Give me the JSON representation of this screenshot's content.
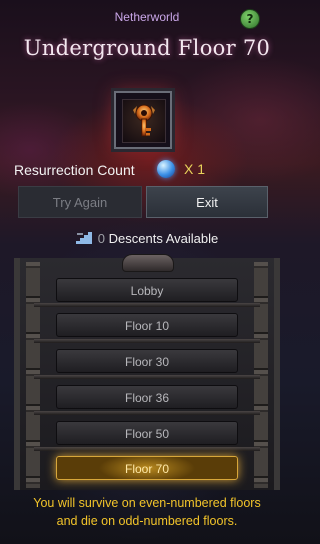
{
  "header": {
    "subtitle": "Netherworld",
    "title": "Underground Floor 70",
    "help_label": "?"
  },
  "reward": {
    "icon": "key-icon"
  },
  "resurrection": {
    "label": "Resurrection Count",
    "orb_icon": "blue-orb-icon",
    "count_text": "X 1"
  },
  "buttons": {
    "try_again": "Try Again",
    "exit": "Exit"
  },
  "descents": {
    "icon": "stairs-icon",
    "count": "0",
    "label": "Descents Available"
  },
  "floors": [
    {
      "label": "Lobby",
      "active": false
    },
    {
      "label": "Floor 10",
      "active": false
    },
    {
      "label": "Floor 30",
      "active": false
    },
    {
      "label": "Floor 36",
      "active": false
    },
    {
      "label": "Floor 50",
      "active": false
    },
    {
      "label": "Floor 70",
      "active": true
    }
  ],
  "warning": {
    "line1": "You will survive on even-numbered floors",
    "line2": "and die on odd-numbered floors."
  },
  "colors": {
    "accent_gold": "#f2c42a",
    "title_purple": "#c9a6e8",
    "active_floor_glow": "#d8a73a"
  }
}
